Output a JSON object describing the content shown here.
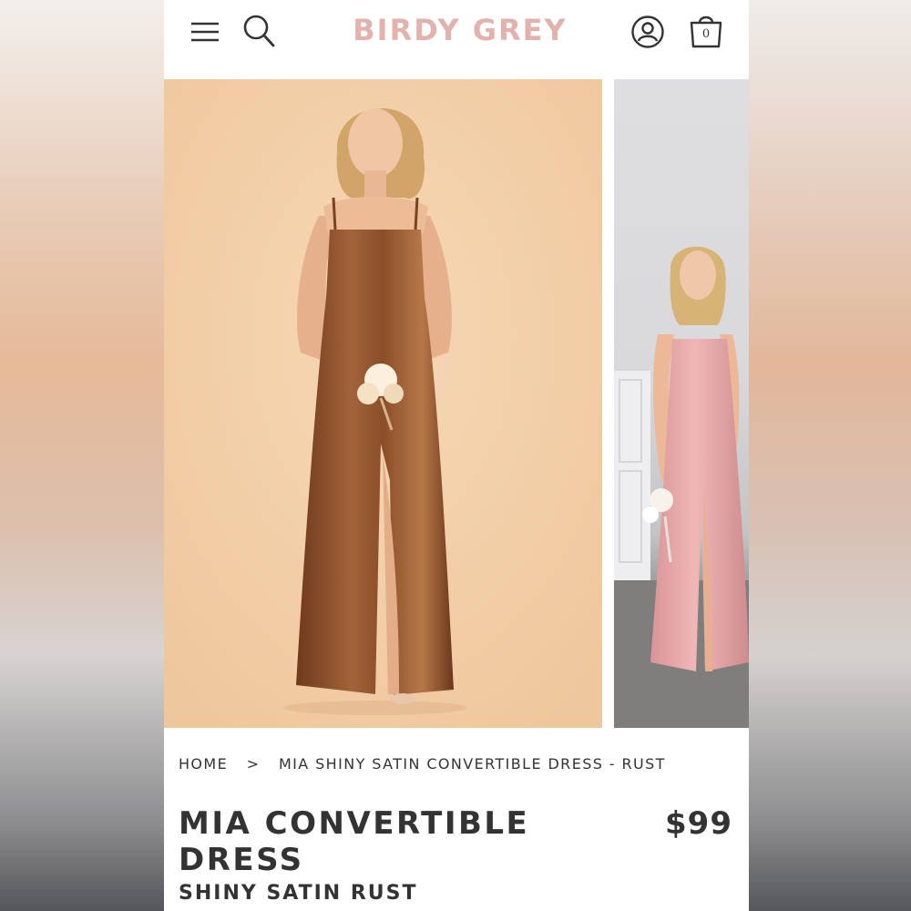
{
  "header": {
    "logo": "BIRDY GREY",
    "bag_count": "0",
    "icons": {
      "menu": "menu-icon",
      "search": "search-icon",
      "account": "account-icon",
      "bag": "shopping-bag-icon"
    }
  },
  "gallery": {
    "slides": [
      {
        "dress_color": "rust",
        "background": "#f2cfa8"
      },
      {
        "dress_color": "pink",
        "background": "#dedee1"
      }
    ]
  },
  "breadcrumb": {
    "home": "HOME",
    "separator": ">",
    "current": "MIA SHINY SATIN CONVERTIBLE DRESS - RUST"
  },
  "product": {
    "title": "MIA CONVERTIBLE DRESS",
    "price": "$99",
    "subtitle": "SHINY SATIN RUST"
  },
  "colors": {
    "logo": "#e2b2ad",
    "text": "#333333",
    "rust_dress": "#8a4e2a",
    "pink_dress": "#e0a3a4"
  }
}
